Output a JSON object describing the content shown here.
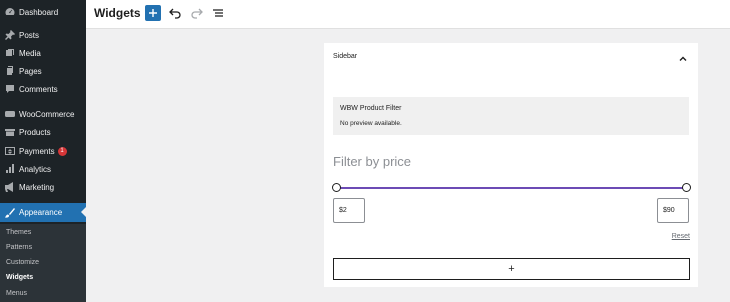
{
  "sidebar": {
    "items": [
      {
        "label": "Dashboard",
        "icon": "dashboard-icon"
      },
      {
        "label": "Posts",
        "icon": "pin-icon"
      },
      {
        "label": "Media",
        "icon": "media-icon"
      },
      {
        "label": "Pages",
        "icon": "pages-icon"
      },
      {
        "label": "Comments",
        "icon": "comment-icon"
      },
      {
        "label": "WooCommerce",
        "icon": "woocommerce-icon"
      },
      {
        "label": "Products",
        "icon": "products-icon"
      },
      {
        "label": "Payments",
        "icon": "payments-icon",
        "badge": "1"
      },
      {
        "label": "Analytics",
        "icon": "analytics-icon"
      },
      {
        "label": "Marketing",
        "icon": "megaphone-icon"
      },
      {
        "label": "Appearance",
        "icon": "brush-icon"
      }
    ],
    "submenu": [
      "Themes",
      "Patterns",
      "Customize",
      "Widgets",
      "Menus"
    ]
  },
  "header": {
    "title": "Widgets"
  },
  "panel": {
    "title": "Sidebar",
    "preview_name": "WBW Product Filter",
    "preview_text": "No preview available.",
    "filter_title": "Filter by price",
    "min_price": "$2",
    "max_price": "$90",
    "reset_label": "Reset",
    "add_block_label": "+"
  },
  "colors": {
    "sidebar_bg": "#1d2327",
    "accent": "#2271b1",
    "slider": "#6c4bb5",
    "badge": "#d63638"
  }
}
